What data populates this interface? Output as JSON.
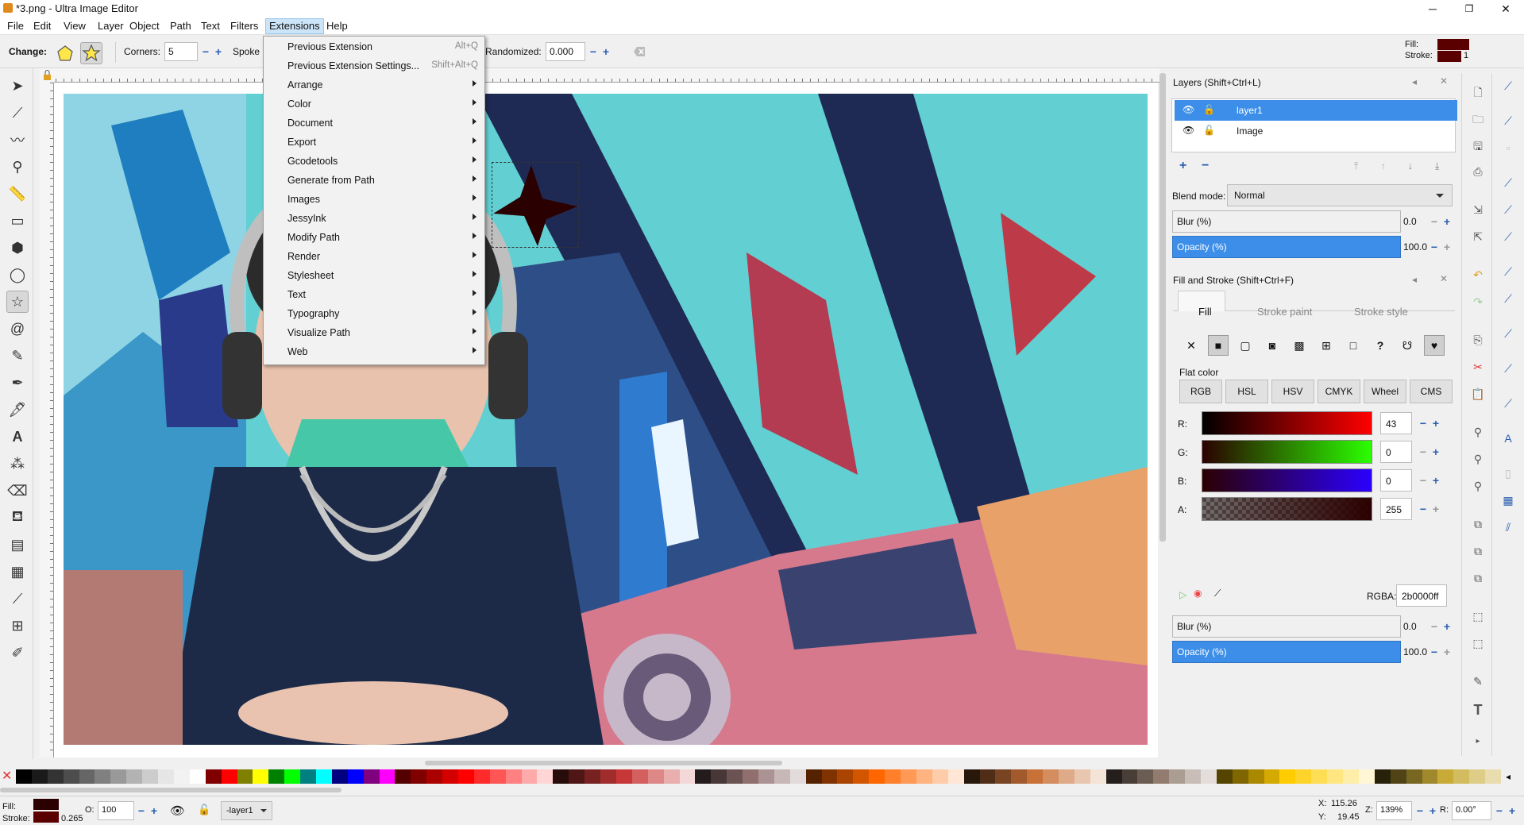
{
  "window": {
    "title": "*3.png - Ultra Image Editor",
    "minimize": "─",
    "maximize": "❐",
    "close": "✕"
  },
  "menubar": {
    "items": [
      "File",
      "Edit",
      "View",
      "Layer",
      "Object",
      "Path",
      "Text",
      "Filters",
      "Extensions",
      "Help"
    ],
    "active": "Extensions"
  },
  "toolctl": {
    "change_label": "Change:",
    "corners_label": "Corners:",
    "corners_value": "5",
    "spoke_label": "Spoke r",
    "randomized_label": "Randomized:",
    "randomized_value": "0.000",
    "fill_label": "Fill:",
    "stroke_label": "Stroke:",
    "stroke_width": "1"
  },
  "ext_menu": {
    "items": [
      {
        "label": "Previous Extension",
        "shortcut": "Alt+Q"
      },
      {
        "label": "Previous Extension Settings...",
        "shortcut": "Shift+Alt+Q"
      },
      {
        "label": "Arrange",
        "submenu": true
      },
      {
        "label": "Color",
        "submenu": true
      },
      {
        "label": "Document",
        "submenu": true
      },
      {
        "label": "Export",
        "submenu": true
      },
      {
        "label": "Gcodetools",
        "submenu": true
      },
      {
        "label": "Generate from Path",
        "submenu": true
      },
      {
        "label": "Images",
        "submenu": true
      },
      {
        "label": "JessyInk",
        "submenu": true
      },
      {
        "label": "Modify Path",
        "submenu": true
      },
      {
        "label": "Render",
        "submenu": true
      },
      {
        "label": "Stylesheet",
        "submenu": true
      },
      {
        "label": "Text",
        "submenu": true
      },
      {
        "label": "Typography",
        "submenu": true
      },
      {
        "label": "Visualize Path",
        "submenu": true
      },
      {
        "label": "Web",
        "submenu": true
      }
    ]
  },
  "layers": {
    "title": "Layers (Shift+Ctrl+L)",
    "rows": [
      {
        "name": "layer1",
        "selected": true
      },
      {
        "name": "Image",
        "selected": false
      }
    ],
    "blend_label": "Blend mode:",
    "blend_value": "Normal",
    "blur_label": "Blur (%)",
    "blur_value": "0.0",
    "opacity_label": "Opacity (%)",
    "opacity_value": "100.0"
  },
  "fill_stroke": {
    "title": "Fill and Stroke (Shift+Ctrl+F)",
    "tabs": [
      "Fill",
      "Stroke paint",
      "Stroke style"
    ],
    "flat_color_label": "Flat color",
    "modes": [
      "RGB",
      "HSL",
      "HSV",
      "CMYK",
      "Wheel",
      "CMS"
    ],
    "channels": [
      {
        "label": "R:",
        "value": "43"
      },
      {
        "label": "G:",
        "value": "0"
      },
      {
        "label": "B:",
        "value": "0"
      },
      {
        "label": "A:",
        "value": "255"
      }
    ],
    "rgba_label": "RGBA:",
    "rgba_value": "2b0000ff",
    "blur_label": "Blur (%)",
    "blur_value": "0.0",
    "opacity_label": "Opacity (%)",
    "opacity_value": "100.0",
    "fill_color": "#2b0000"
  },
  "statusbar": {
    "fill_label": "Fill:",
    "stroke_label": "Stroke:",
    "stroke_width": "0.265",
    "o_label": "O:",
    "o_value": "100",
    "layer_value": "-layer1",
    "x_label": "X:",
    "x_value": "115.26",
    "y_label": "Y:",
    "y_value": "19.45",
    "z_label": "Z:",
    "zoom_value": "139%",
    "r_label": "R:",
    "rotation_value": "0.00°"
  },
  "palette": [
    "#000000",
    "#1a1a1a",
    "#333333",
    "#4d4d4d",
    "#666666",
    "#808080",
    "#999999",
    "#b3b3b3",
    "#cccccc",
    "#e6e6e6",
    "#f2f2f2",
    "#ffffff",
    "#800000",
    "#ff0000",
    "#808000",
    "#ffff00",
    "#008000",
    "#00ff00",
    "#008080",
    "#00ffff",
    "#000080",
    "#0000ff",
    "#800080",
    "#ff00ff",
    "#550000",
    "#800000",
    "#aa0000",
    "#d40000",
    "#ff0000",
    "#ff2a2a",
    "#ff5555",
    "#ff8080",
    "#ffaaaa",
    "#ffd5d5",
    "#280b0b",
    "#501616",
    "#782121",
    "#a02c2c",
    "#c83737",
    "#d35f5f",
    "#de8787",
    "#e9afaf",
    "#f4d7d7",
    "#241c1c",
    "#483737",
    "#6c5353",
    "#916f6f",
    "#ac9393",
    "#c8b7b7",
    "#e3dbdb",
    "#552200",
    "#803300",
    "#aa4400",
    "#d45500",
    "#ff6600",
    "#ff7f2a",
    "#ff9955",
    "#ffb380",
    "#ffccaa",
    "#ffe6d5",
    "#28170b",
    "#502d16",
    "#784421",
    "#a05a2c",
    "#c87137",
    "#d38d5f",
    "#deaa87",
    "#e9c6af",
    "#f4e3d7",
    "#241f1c",
    "#483e37",
    "#6c5d53",
    "#917c6f",
    "#ac9d93",
    "#c8beb7",
    "#e3dedb",
    "#554400",
    "#806600",
    "#aa8800",
    "#d4aa00",
    "#ffcc00",
    "#ffd42a",
    "#ffdd55",
    "#ffe680",
    "#ffeeaa",
    "#fff6d5",
    "#28220b",
    "#504416",
    "#786721",
    "#a0892c",
    "#c8ab37",
    "#d3bc5f",
    "#decd87",
    "#e9ddaf"
  ]
}
